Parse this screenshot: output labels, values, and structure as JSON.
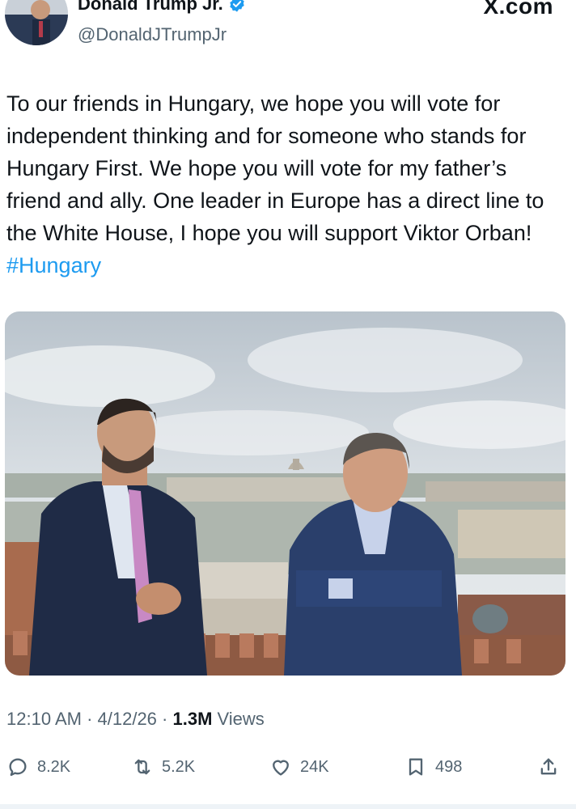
{
  "header": {
    "display_name": "Donald Trump Jr.",
    "handle": "@DonaldJTrumpJr",
    "source": "X.com"
  },
  "tweet": {
    "text": "To our friends in Hungary, we hope you will vote for independent thinking and for someone who stands for Hungary First. We hope you will vote for my father’s friend and ally. One leader in Europe has a direct line to the White House, I hope you will support Viktor Orban! ",
    "hashtag": "#Hungary"
  },
  "meta": {
    "time": "12:10 AM",
    "separator1": " · ",
    "date": "4/12/26",
    "separator2": " · ",
    "views_count": "1.3M",
    "views_label": " Views"
  },
  "actions": {
    "replies": "8.2K",
    "reposts": "5.2K",
    "likes": "24K",
    "bookmarks": "498"
  },
  "icons": {
    "verified": "verified-badge-icon",
    "reply": "reply-icon",
    "repost": "repost-icon",
    "like": "heart-icon",
    "bookmark": "bookmark-icon",
    "share": "share-icon"
  },
  "colors": {
    "accent": "#1d9bf0",
    "text": "#0f1419",
    "secondary": "#536471"
  }
}
